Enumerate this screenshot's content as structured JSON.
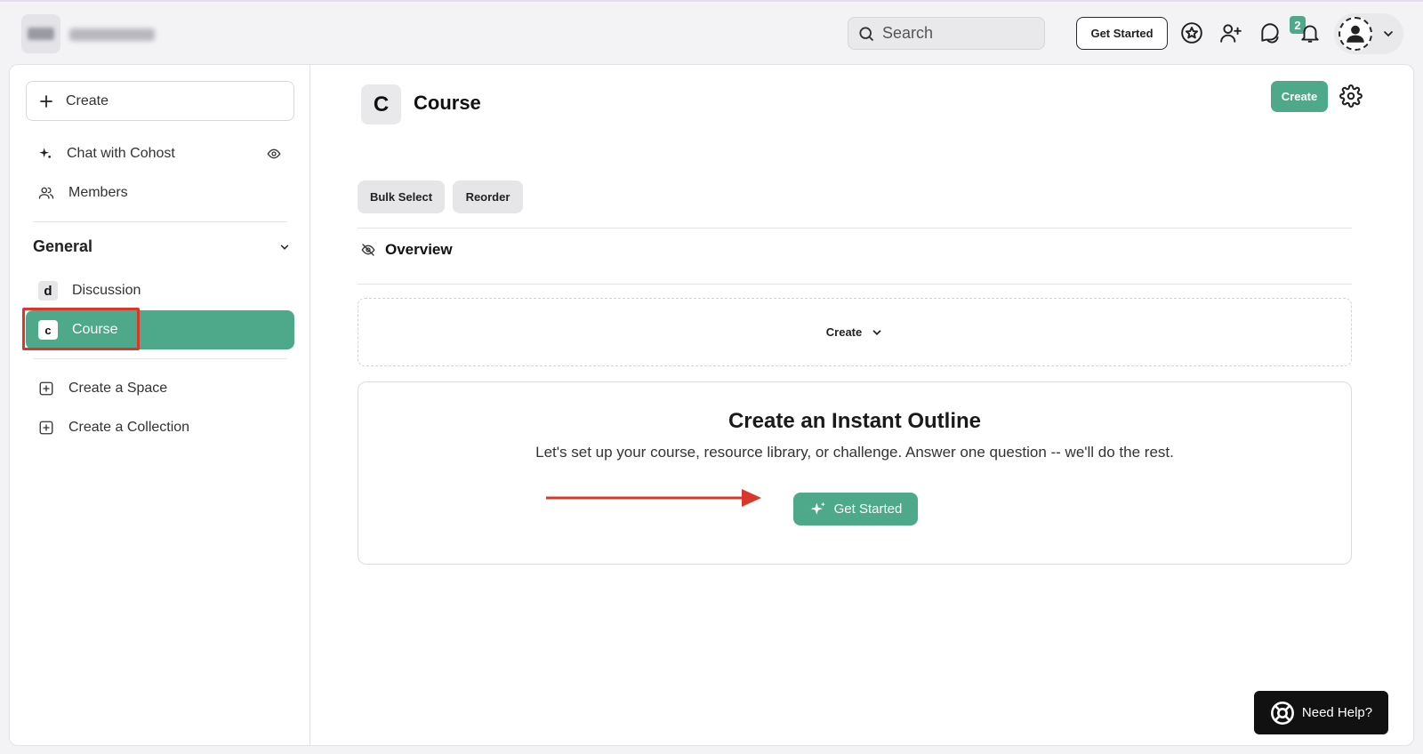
{
  "header": {
    "search_placeholder": "Search",
    "get_started_label": "Get Started",
    "notification_count": "2"
  },
  "sidebar": {
    "create_label": "Create",
    "top_items": [
      {
        "label": "Chat with Cohost",
        "icon": "sparkle-icon"
      },
      {
        "label": "Members",
        "icon": "members-icon"
      }
    ],
    "section_title": "General",
    "section_items": [
      {
        "label": "Discussion",
        "chip": "d"
      },
      {
        "label": "Course",
        "chip": "c",
        "active": true
      }
    ],
    "bottom_items": [
      {
        "label": "Create a Space",
        "icon": "plus-square-icon"
      },
      {
        "label": "Create a Collection",
        "icon": "plus-square-icon"
      }
    ]
  },
  "page": {
    "chip": "C",
    "title": "Course",
    "create_label": "Create",
    "bulk_select_label": "Bulk Select",
    "reorder_label": "Reorder",
    "overview_label": "Overview",
    "dropdown_create_label": "Create"
  },
  "outline": {
    "title": "Create an Instant Outline",
    "subtitle": "Let's set up your course, resource library, or challenge. Answer one question -- we'll do the rest.",
    "button_label": "Get Started"
  },
  "help": {
    "label": "Need Help?"
  },
  "colors": {
    "accent": "#4ea98a",
    "annotation": "#d9372b"
  }
}
